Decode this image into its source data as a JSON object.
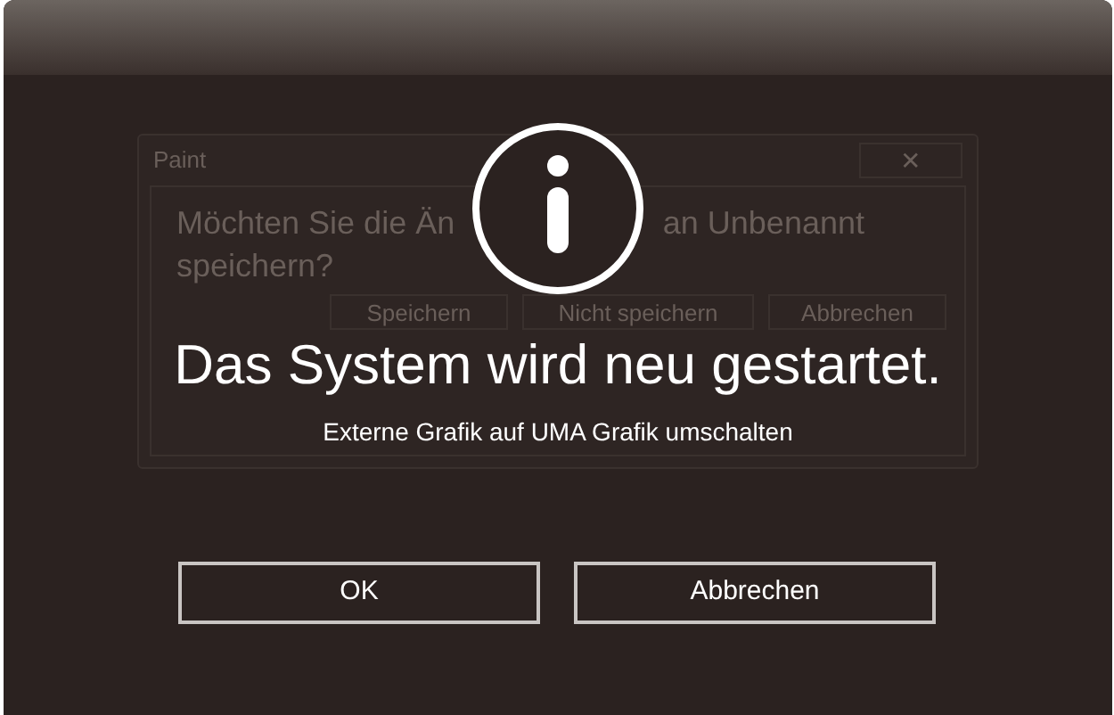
{
  "background_dialog": {
    "title": "Paint",
    "close": "✕",
    "message_parts": [
      "Möchten Sie die Än",
      "an Unbenannt",
      "speichern?"
    ],
    "buttons": [
      "Speichern",
      "Nicht speichern",
      "Abbrechen"
    ]
  },
  "title": "Das System wird neu gestartet.",
  "message": "Externe Grafik auf UMA Grafik umschalten",
  "buttons": [
    "OK",
    "Abbrechen"
  ]
}
